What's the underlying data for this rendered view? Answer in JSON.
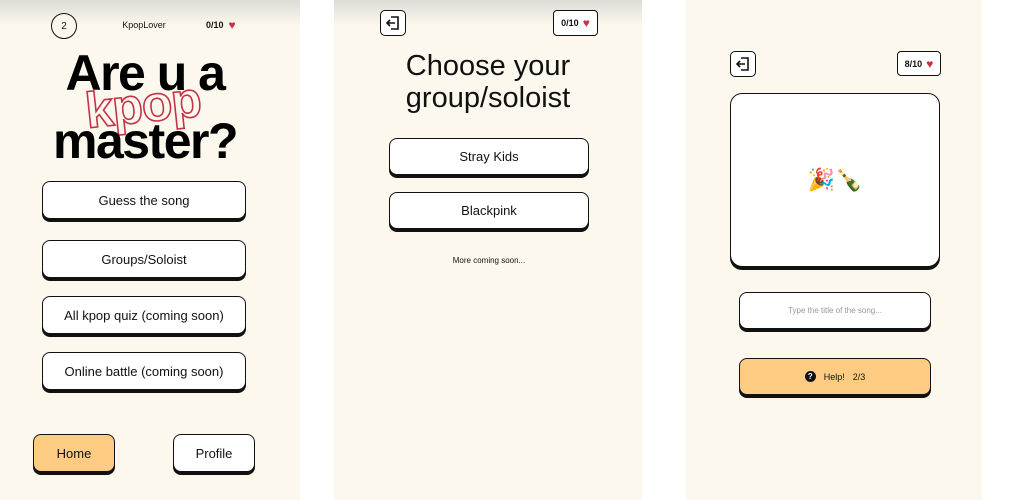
{
  "screen1": {
    "level_number": "2",
    "username": "KpopLover",
    "score": "0/10",
    "title_line1": "Are u a",
    "title_overlay": "kpop",
    "title_line2": "master?",
    "menu": [
      {
        "label": "Guess the song"
      },
      {
        "label": "Groups/Soloist"
      },
      {
        "label": "All kpop quiz (coming soon)"
      },
      {
        "label": "Online battle (coming soon)"
      }
    ],
    "nav": {
      "home": "Home",
      "profile": "Profile"
    }
  },
  "screen2": {
    "score": "0/10",
    "title_line1": "Choose your",
    "title_line2": "group/soloist",
    "groups": [
      {
        "label": "Stray Kids"
      },
      {
        "label": "Blackpink"
      }
    ],
    "more": "More coming soon..."
  },
  "screen3": {
    "score": "8/10",
    "emojis": "🎉🍾",
    "answer_placeholder": "Type the title of the song...",
    "help_label": "Help!",
    "help_count": "2/3"
  },
  "colors": {
    "background": "#fdf8ed",
    "accent": "#fecb83",
    "heart": "#c4324a",
    "border": "#111111"
  },
  "icons": {
    "exit": "exit-icon",
    "heart": "heart-icon",
    "help": "question-icon"
  }
}
